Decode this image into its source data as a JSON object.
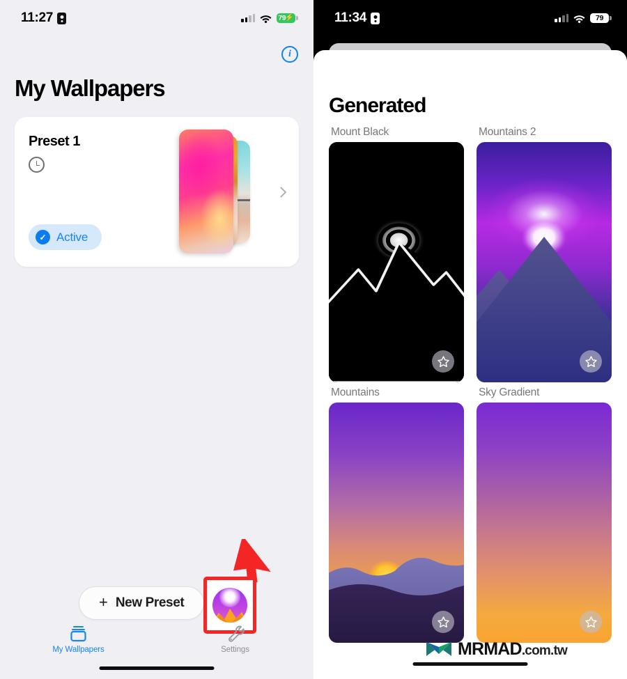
{
  "left": {
    "status_bar": {
      "time": "11:27",
      "recording_icon": "screen-record-badge-icon",
      "signal_icon": "cellular-signal-icon",
      "wifi_icon": "wifi-icon",
      "battery_percent": "79",
      "battery_charging": true,
      "battery_color": "#34c759"
    },
    "info_button": "i",
    "page_title": "My Wallpapers",
    "preset_card": {
      "name": "Preset 1",
      "schedule_icon": "clock-icon",
      "status_label": "Active",
      "status_accent": "#1785f5",
      "status_bg": "#d6e8fb",
      "chevron_icon": "chevron-right-icon"
    },
    "new_preset_button": {
      "plus_icon": "plus-icon",
      "label": "New Preset"
    },
    "app_icon": {
      "name": "wallpaper-app-icon",
      "highlight_color": "#f42525"
    },
    "annotation": {
      "arrow_color": "#f42525",
      "arrow_icon": "red-arrow-cursor"
    },
    "tab_bar": [
      {
        "label": "My Wallpapers",
        "icon": "stacked-cards-icon",
        "active": true,
        "color": "#1785f5"
      },
      {
        "label": "Settings",
        "icon": "wrench-icon",
        "active": false,
        "color": "#8e8e93"
      }
    ]
  },
  "right": {
    "status_bar": {
      "time": "11:34",
      "recording_icon": "screen-record-badge-icon",
      "signal_icon": "cellular-signal-icon",
      "wifi_icon": "wifi-icon",
      "battery_percent": "79",
      "battery_charging": false,
      "battery_color": "#ffffff"
    },
    "sheet_title": "Generated",
    "wallpapers": [
      {
        "label": "Mount Black",
        "favorite_icon": "star-outline-icon",
        "favorited": false
      },
      {
        "label": "Mountains 2",
        "favorite_icon": "star-outline-icon",
        "favorited": false
      },
      {
        "label": "Mountains",
        "favorite_icon": "star-outline-icon",
        "favorited": false
      },
      {
        "label": "Sky Gradient",
        "favorite_icon": "star-outline-icon",
        "favorited": false
      }
    ],
    "watermark": {
      "logo_icon": "mrmad-logo-icon",
      "brand": "MRMAD",
      "domain": ".com.tw"
    }
  }
}
